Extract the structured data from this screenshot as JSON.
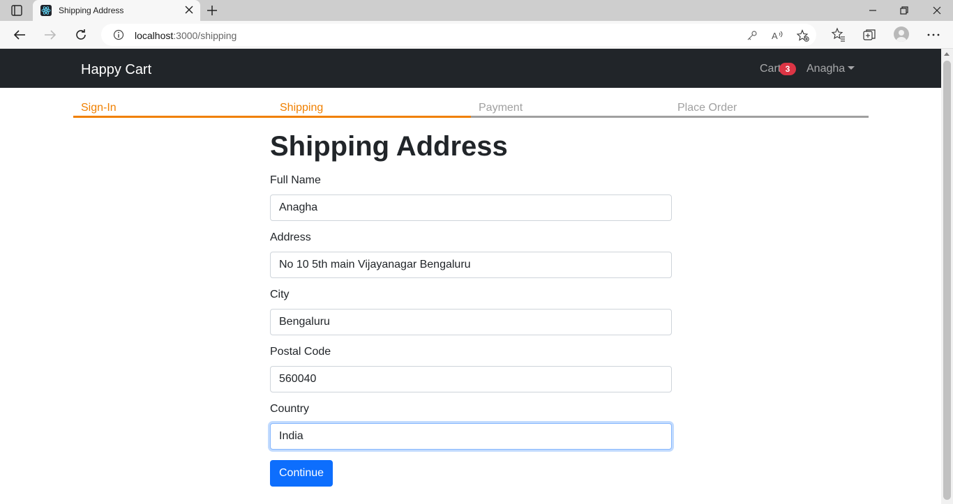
{
  "browser": {
    "tab_title": "Shipping Address",
    "url_host": "localhost",
    "url_path": ":3000/shipping"
  },
  "navbar": {
    "brand": "Happy Cart",
    "cart_label": "Cart",
    "cart_count": "3",
    "user_name": "Anagha"
  },
  "steps": [
    {
      "label": "Sign-In",
      "active": true
    },
    {
      "label": "Shipping",
      "active": true
    },
    {
      "label": "Payment",
      "active": false
    },
    {
      "label": "Place Order",
      "active": false
    }
  ],
  "form": {
    "title": "Shipping Address",
    "fields": [
      {
        "label": "Full Name",
        "value": "Anagha"
      },
      {
        "label": "Address",
        "value": "No 10 5th main Vijayanagar Bengaluru"
      },
      {
        "label": "City",
        "value": "Bengaluru"
      },
      {
        "label": "Postal Code",
        "value": "560040"
      },
      {
        "label": "Country",
        "value": "India"
      }
    ],
    "submit_label": "Continue"
  },
  "colors": {
    "navbar_bg": "#212529",
    "step_active": "#f08000",
    "step_inactive": "#a0a0a0",
    "primary": "#0d6efd",
    "badge": "#dc3545"
  },
  "icons": [
    "tab-actions-icon",
    "react-favicon-icon",
    "close-icon",
    "plus-icon",
    "minimize-icon",
    "restore-icon",
    "back-arrow-icon",
    "forward-arrow-icon",
    "refresh-icon",
    "info-icon",
    "key-icon",
    "read-aloud-icon",
    "add-favorite-icon",
    "favorites-icon",
    "collections-icon",
    "profile-icon",
    "more-icon"
  ]
}
